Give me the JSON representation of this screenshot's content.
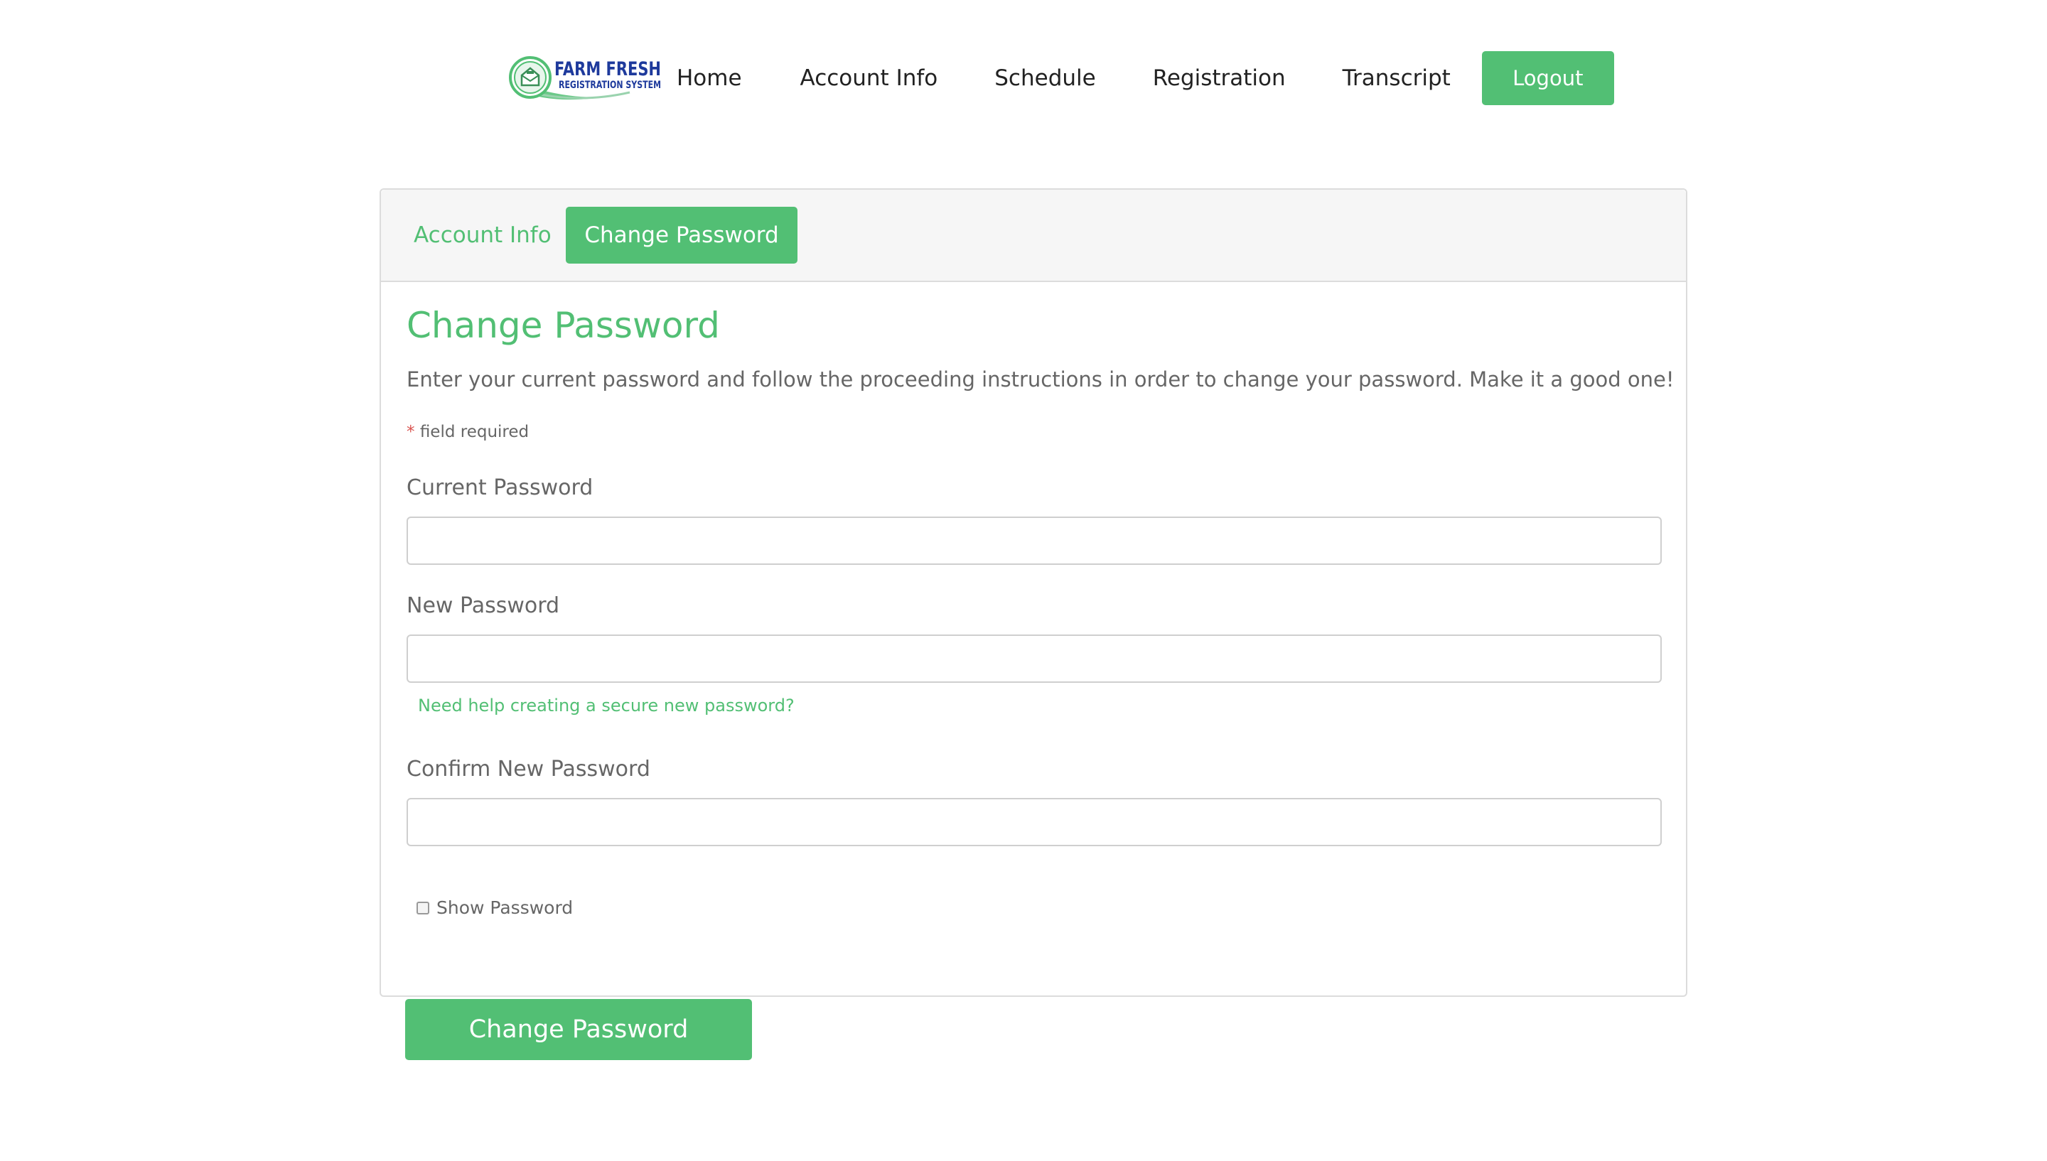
{
  "brand": {
    "logo_line1": "FARM FRESH",
    "logo_line2": "REGISTRATION SYSTEM",
    "logo_icon": "barn-envelope-icon",
    "primary_color": "#52bf74",
    "logo_text_color": "#1e3a9c"
  },
  "nav": {
    "home": "Home",
    "account_info": "Account Info",
    "schedule": "Schedule",
    "registration": "Registration",
    "transcript": "Transcript",
    "logout": "Logout"
  },
  "tabs": {
    "account_info": "Account Info",
    "change_password": "Change Password",
    "active": "Change Password"
  },
  "form": {
    "title": "Change Password",
    "intro": "Enter your current password and follow the proceeding instructions in order to change your password. Make it a good one!",
    "required_star": "*",
    "required_text": "field required",
    "current_password_label": "Current Password",
    "current_password_value": "",
    "new_password_label": "New Password",
    "new_password_value": "",
    "help_link": "Need help creating a secure new password?",
    "confirm_password_label": "Confirm New Password",
    "confirm_password_value": "",
    "show_password_label": "Show Password",
    "show_password_checked": false,
    "submit_label": "Change Password"
  }
}
